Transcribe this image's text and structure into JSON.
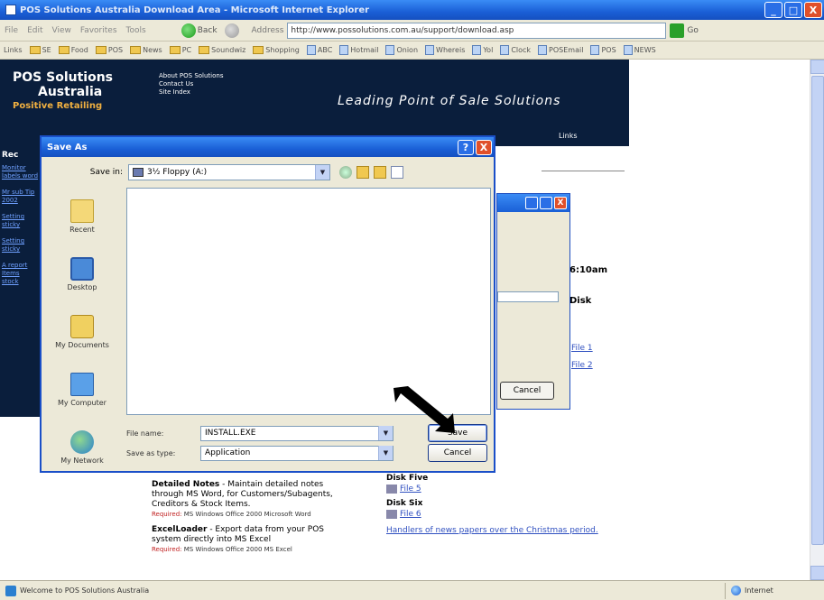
{
  "window": {
    "title": "POS Solutions Australia Download Area - Microsoft Internet Explorer",
    "min": "_",
    "max": "□",
    "close": "X"
  },
  "menu": {
    "items": [
      "File",
      "Edit",
      "View",
      "Favorites",
      "Tools"
    ],
    "back": "Back",
    "address_label": "Address",
    "address_value": "http://www.possolutions.com.au/support/download.asp",
    "go_label": "Go"
  },
  "links": {
    "label": "Links",
    "items": [
      {
        "label": "SE",
        "icon": "folder-icon"
      },
      {
        "label": "Food",
        "icon": "folder-icon"
      },
      {
        "label": "POS",
        "icon": "folder-icon"
      },
      {
        "label": "News",
        "icon": "folder-icon"
      },
      {
        "label": "PC",
        "icon": "folder-icon"
      },
      {
        "label": "Soundwiz",
        "icon": "folder-icon"
      },
      {
        "label": "Shopping",
        "icon": "folder-icon"
      },
      {
        "label": "ABC",
        "icon": "page-icon"
      },
      {
        "label": "Hotmail",
        "icon": "page-icon"
      },
      {
        "label": "Onion",
        "icon": "page-icon"
      },
      {
        "label": "Whereis",
        "icon": "page-icon"
      },
      {
        "label": "Yol",
        "icon": "page-icon"
      },
      {
        "label": "Clock",
        "icon": "page-icon"
      },
      {
        "label": "POSEmail",
        "icon": "page-icon"
      },
      {
        "label": "POS",
        "icon": "page-icon"
      },
      {
        "label": "NEWS",
        "icon": "page-icon"
      }
    ]
  },
  "banner": {
    "logo_line1": "POS Solutions",
    "logo_line2": "Australia",
    "logo_line3": "Positive Retailing",
    "top_links": [
      "About POS Solutions",
      "Contact Us",
      "Site Index"
    ],
    "tagline": "Leading Point of Sale Solutions",
    "nav_link": "Links"
  },
  "leftnav": {
    "heading": "Rec",
    "links": [
      "Monitor labels word",
      "Mr sub Tip 2002",
      "Setting sticky",
      "Setting sticky",
      "A report Items stock"
    ]
  },
  "background": {
    "time_text": "6:10am",
    "disk_text": "Disk",
    "file1": "File 1",
    "file2": "File 2",
    "cancel": "Cancel"
  },
  "bottom": {
    "detailed_title": "Detailed Notes",
    "detailed_text": " - Maintain detailed notes through MS Word, for Customers/Subagents, Creditors & Stock Items.",
    "detailed_req_label": "Required:",
    "detailed_req": " MS Windows Office 2000 Microsoft Word",
    "excel_title": "ExcelLoader",
    "excel_text": " - Export data from your POS system directly into MS Excel",
    "excel_req_label": "Required:",
    "excel_req": " MS Windows Office 2000 MS Excel",
    "disk_five": "Disk Five",
    "file5": "File 5",
    "disk_six": "Disk Six",
    "file6": "File 6",
    "news": "Handlers of news papers over the Christmas period."
  },
  "saveas": {
    "title": "Save As",
    "help": "?",
    "close": "X",
    "save_in_label": "Save in:",
    "save_in_value": "3½ Floppy (A:)",
    "places": [
      {
        "label": "Recent",
        "icon": "recent-icon"
      },
      {
        "label": "Desktop",
        "icon": "desktop-icon"
      },
      {
        "label": "My Documents",
        "icon": "my-documents-icon"
      },
      {
        "label": "My Computer",
        "icon": "my-computer-icon"
      },
      {
        "label": "My Network",
        "icon": "my-network-icon"
      }
    ],
    "filename_label": "File name:",
    "filename_value": "INSTALL.EXE",
    "savetype_label": "Save as type:",
    "savetype_value": "Application",
    "save_button": "Save",
    "cancel_button": "Cancel"
  },
  "status": {
    "text": "Welcome to POS Solutions Australia",
    "zone": "Internet"
  }
}
